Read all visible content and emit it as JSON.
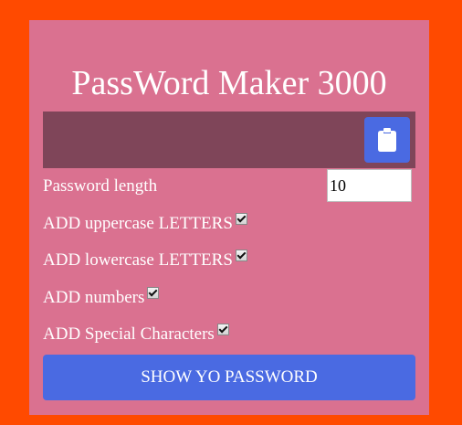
{
  "app": {
    "title": "PassWord Maker 3000"
  },
  "result": {
    "value": "",
    "copy_icon": "clipboard-icon"
  },
  "length": {
    "label": "Password length",
    "value": "10"
  },
  "options": {
    "uppercase": {
      "label": "ADD uppercase LETTERS",
      "checked": true
    },
    "lowercase": {
      "label": "ADD lowercase LETTERS",
      "checked": true
    },
    "numbers": {
      "label": "ADD numbers",
      "checked": true
    },
    "special": {
      "label": "ADD Special Characters",
      "checked": true
    }
  },
  "submit": {
    "label": "SHOW YO PASSWORD"
  },
  "colors": {
    "page_background": "#ff4a00",
    "panel_background": "#da7190",
    "result_background": "#7f4559",
    "button_accent": "#4a6ae2",
    "text": "#ffffff"
  }
}
